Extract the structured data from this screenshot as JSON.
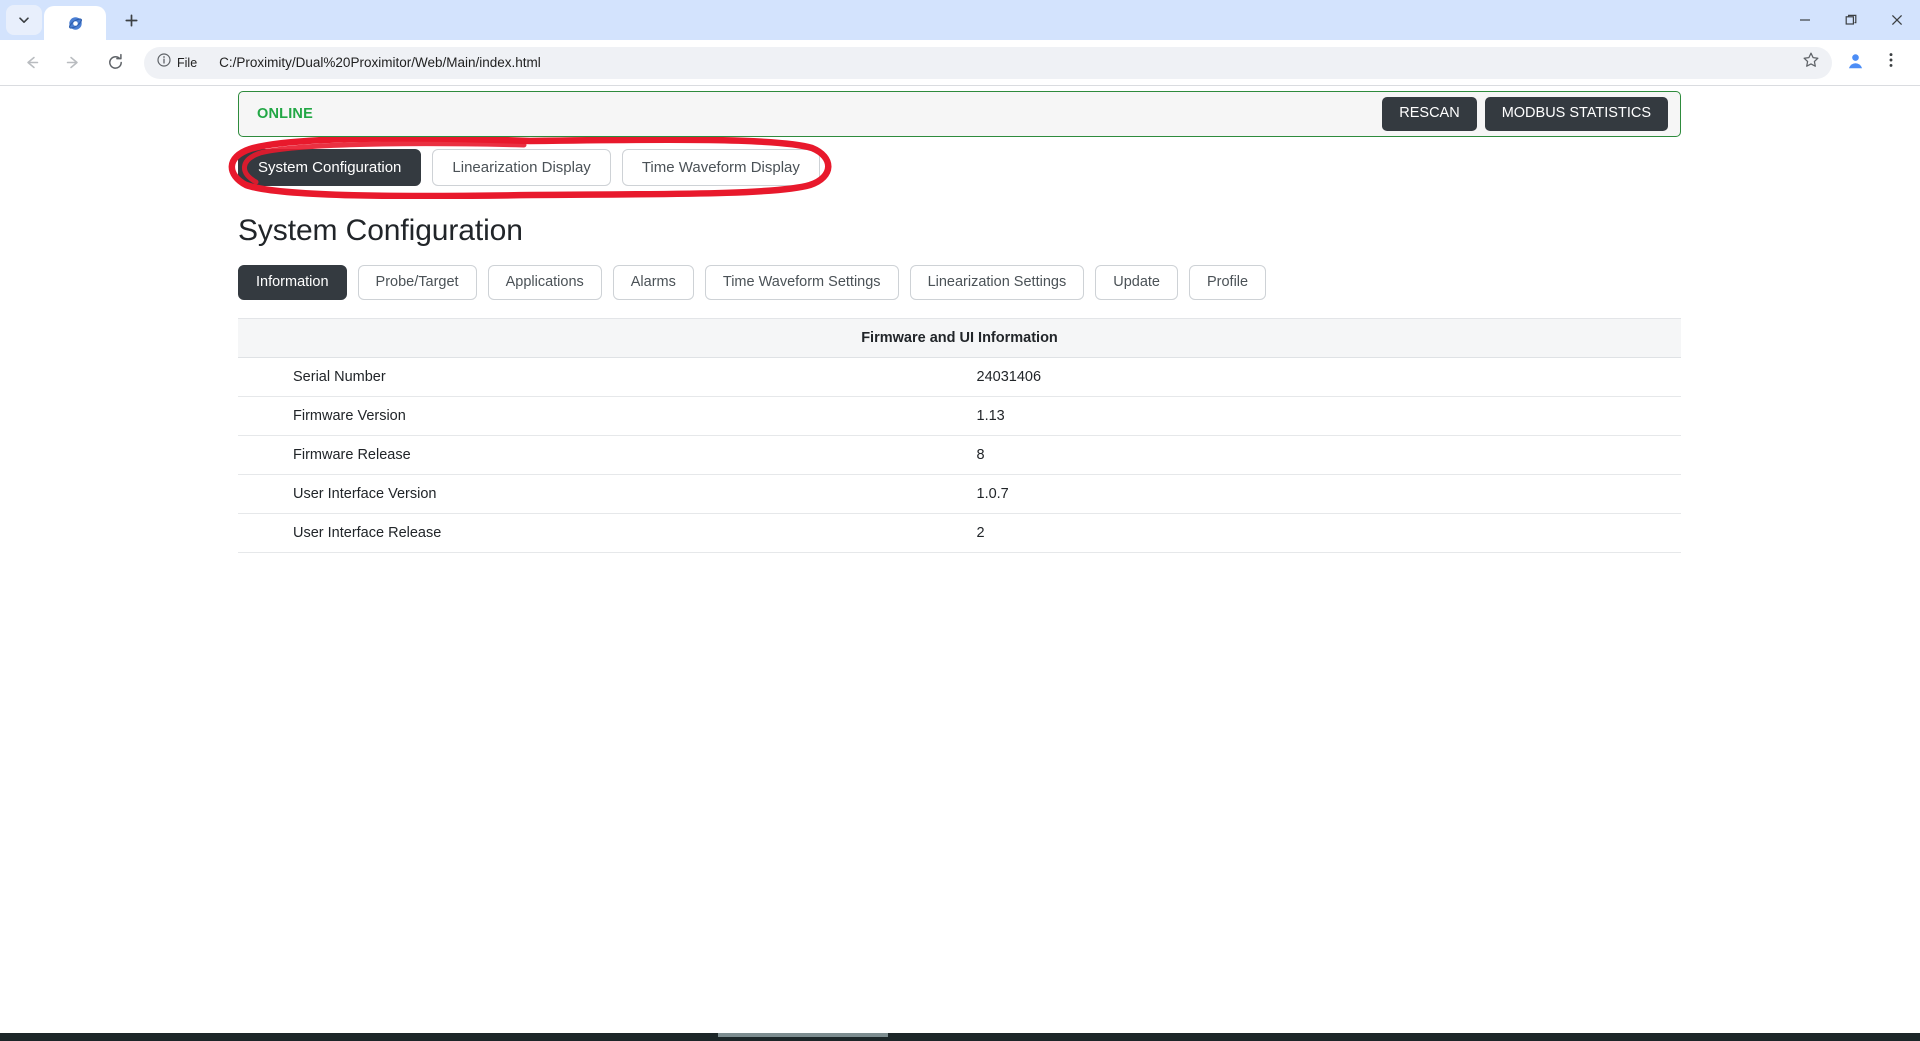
{
  "browser": {
    "tab": {
      "title": "",
      "favicon": "globe-favicon"
    },
    "new_tab_label": "+",
    "window_controls": {
      "minimize": "minimize-icon",
      "maximize": "maximize-icon",
      "close": "close-icon"
    },
    "nav": {
      "back": "back-arrow-icon",
      "forward": "forward-arrow-icon",
      "reload": "reload-icon"
    },
    "omnibox": {
      "chip_label": "File",
      "chip_icon": "info-circle-icon",
      "url": "C:/Proximity/Dual%20Proximitor/Web/Main/index.html",
      "bookmark_icon": "star-icon"
    },
    "profile_icon": "profile-avatar-icon",
    "menu_icon": "three-dot-menu-icon"
  },
  "page": {
    "status_banner": {
      "status": "ONLINE",
      "buttons": [
        {
          "label": "RESCAN"
        },
        {
          "label": "MODBUS STATISTICS"
        }
      ]
    },
    "main_tabs": [
      {
        "label": "System Configuration",
        "active": true
      },
      {
        "label": "Linearization Display",
        "active": false
      },
      {
        "label": "Time Waveform Display",
        "active": false
      }
    ],
    "annotation": {
      "type": "red-oval-highlight",
      "color": "#e8192c",
      "targets": "main-tabs"
    },
    "title": "System Configuration",
    "sub_tabs": [
      {
        "label": "Information",
        "active": true
      },
      {
        "label": "Probe/Target",
        "active": false
      },
      {
        "label": "Applications",
        "active": false
      },
      {
        "label": "Alarms",
        "active": false
      },
      {
        "label": "Time Waveform Settings",
        "active": false
      },
      {
        "label": "Linearization Settings",
        "active": false
      },
      {
        "label": "Update",
        "active": false
      },
      {
        "label": "Profile",
        "active": false
      }
    ],
    "table": {
      "header": "Firmware and UI Information",
      "rows": [
        {
          "key": "Serial Number",
          "value": "24031406"
        },
        {
          "key": "Firmware Version",
          "value": "1.13"
        },
        {
          "key": "Firmware Release",
          "value": "8"
        },
        {
          "key": "User Interface Version",
          "value": "1.0.7"
        },
        {
          "key": "User Interface Release",
          "value": "2"
        }
      ]
    }
  },
  "colors": {
    "accent_dark": "#343a40",
    "online_green": "#22a745",
    "banner_border": "#2e8b3d",
    "annotation_red": "#e8192c",
    "chrome_tabstrip": "#d3e3fd"
  }
}
